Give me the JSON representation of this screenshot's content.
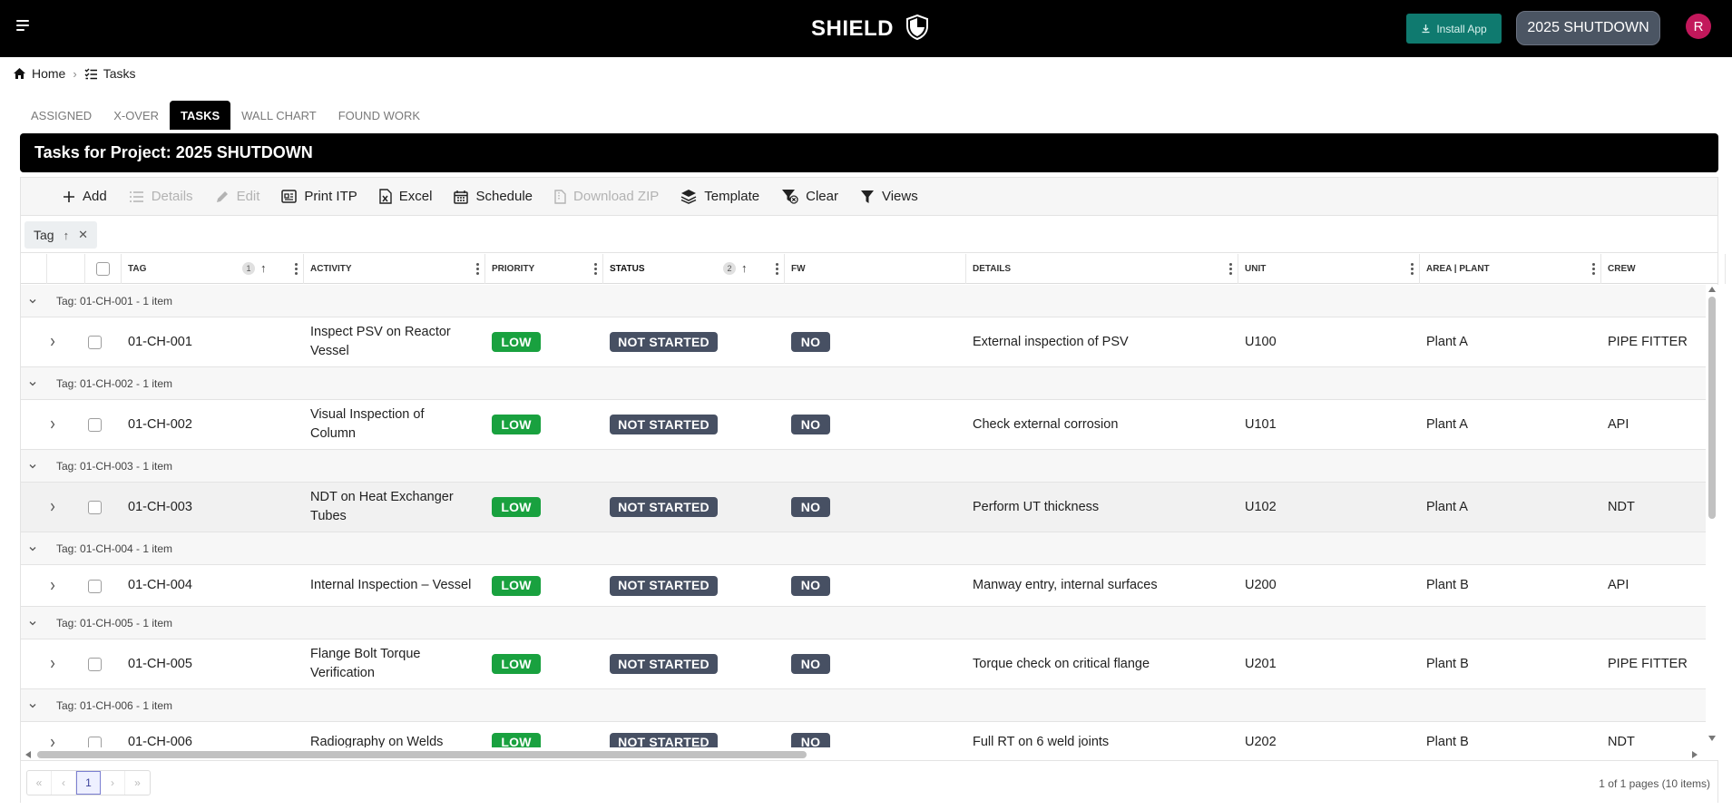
{
  "app": {
    "brand": "SHIELD",
    "install_label": "Install App",
    "project_button": "2025 SHUTDOWN",
    "avatar_initial": "R"
  },
  "breadcrumb": {
    "home": "Home",
    "tasks": "Tasks"
  },
  "tabs": [
    "ASSIGNED",
    "X-OVER",
    "TASKS",
    "WALL CHART",
    "FOUND WORK"
  ],
  "active_tab": "TASKS",
  "title": "Tasks for Project: 2025 SHUTDOWN",
  "toolbar": {
    "add": "Add",
    "details": "Details",
    "edit": "Edit",
    "print_itp": "Print ITP",
    "excel": "Excel",
    "schedule": "Schedule",
    "download_zip": "Download ZIP",
    "template": "Template",
    "clear": "Clear",
    "views": "Views"
  },
  "group_chip": {
    "label": "Tag"
  },
  "columns": {
    "tag": "TAG",
    "tag_sort_order": "1",
    "activity": "ACTIVITY",
    "priority": "PRIORITY",
    "status": "STATUS",
    "status_sort_order": "2",
    "fw": "FW",
    "details": "DETAILS",
    "unit": "UNIT",
    "area_plant": "AREA | PLANT",
    "crew": "CREW"
  },
  "groups": [
    {
      "label": "Tag: 01-CH-001 - 1 item",
      "tag": "01-CH-001",
      "activity_1": "Inspect PSV on Reactor",
      "activity_2": "Vessel",
      "priority": "LOW",
      "status": "NOT STARTED",
      "fw": "NO",
      "details": "External inspection of PSV",
      "unit": "U100",
      "area": "Plant A",
      "crew": "PIPE FITTER"
    },
    {
      "label": "Tag: 01-CH-002 - 1 item",
      "tag": "01-CH-002",
      "activity_1": "Visual Inspection of",
      "activity_2": "Column",
      "priority": "LOW",
      "status": "NOT STARTED",
      "fw": "NO",
      "details": "Check external corrosion",
      "unit": "U101",
      "area": "Plant A",
      "crew": "API"
    },
    {
      "label": "Tag: 01-CH-003 - 1 item",
      "tag": "01-CH-003",
      "activity_1": "NDT on Heat Exchanger",
      "activity_2": "Tubes",
      "priority": "LOW",
      "status": "NOT STARTED",
      "fw": "NO",
      "details": "Perform UT thickness",
      "unit": "U102",
      "area": "Plant A",
      "crew": "NDT"
    },
    {
      "label": "Tag: 01-CH-004 - 1 item",
      "tag": "01-CH-004",
      "activity_1": "Internal Inspection – Vessel",
      "activity_2": "",
      "priority": "LOW",
      "status": "NOT STARTED",
      "fw": "NO",
      "details": "Manway entry, internal surfaces",
      "unit": "U200",
      "area": "Plant B",
      "crew": "API"
    },
    {
      "label": "Tag: 01-CH-005 - 1 item",
      "tag": "01-CH-005",
      "activity_1": "Flange Bolt Torque",
      "activity_2": "Verification",
      "priority": "LOW",
      "status": "NOT STARTED",
      "fw": "NO",
      "details": "Torque check on critical flange",
      "unit": "U201",
      "area": "Plant B",
      "crew": "PIPE FITTER"
    },
    {
      "label": "Tag: 01-CH-006 - 1 item",
      "tag": "01-CH-006",
      "activity_1": "Radiography on Welds",
      "activity_2": "",
      "priority": "LOW",
      "status": "NOT STARTED",
      "fw": "NO",
      "details": "Full RT on 6 weld joints",
      "unit": "U202",
      "area": "Plant B",
      "crew": "NDT"
    }
  ],
  "pagination": {
    "current_page": "1",
    "info": "1 of 1 pages (10 items)"
  },
  "colors": {
    "priority_low": "#19a13f",
    "status_badge": "#475063",
    "install_button": "#0f7a6f",
    "avatar": "#c2185b"
  }
}
